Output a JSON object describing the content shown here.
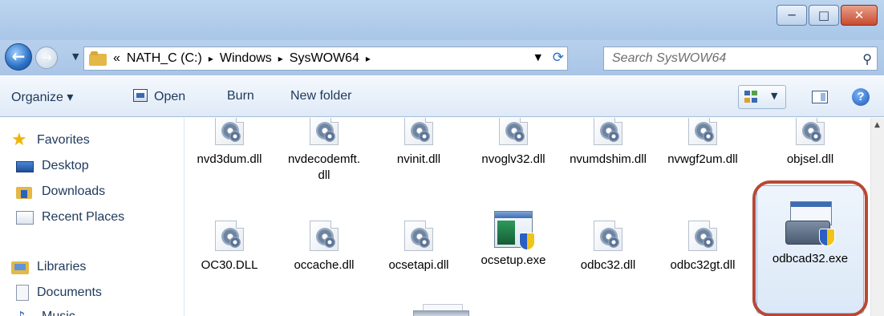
{
  "window": {
    "controls": {
      "minimize": "─",
      "maximize": "□",
      "close": "✕"
    }
  },
  "address": {
    "overflow": "«",
    "crumbs": [
      "NATH_C (C:)",
      "Windows",
      "SysWOW64"
    ],
    "separator": "▸",
    "search_placeholder": "Search SysWOW64"
  },
  "toolbar": {
    "organize_label": "Organize ▾",
    "open_label": "Open",
    "burn_label": "Burn",
    "new_folder_label": "New folder",
    "help_label": "?"
  },
  "nav": {
    "favorites": "Favorites",
    "desktop": "Desktop",
    "downloads": "Downloads",
    "recent_places": "Recent Places",
    "libraries": "Libraries",
    "documents": "Documents",
    "music": "Music"
  },
  "files": {
    "row1": [
      "nvd3dum.dll",
      "nvdecodemft.dll",
      "nvinit.dll",
      "nvoglv32.dll",
      "nvumdshim.dll",
      "nvwgf2um.dll",
      "objsel.dll"
    ],
    "row2": [
      "OC30.DLL",
      "occache.dll",
      "ocsetapi.dll",
      "ocsetup.exe",
      "odbc32.dll",
      "odbc32gt.dll",
      "odbcad32.exe"
    ]
  },
  "highlight_color": "#b84835",
  "icons": {
    "dll": "gear-document-icon",
    "exe": "application-shield-icon",
    "selected": "toolbox-shield-icon"
  }
}
